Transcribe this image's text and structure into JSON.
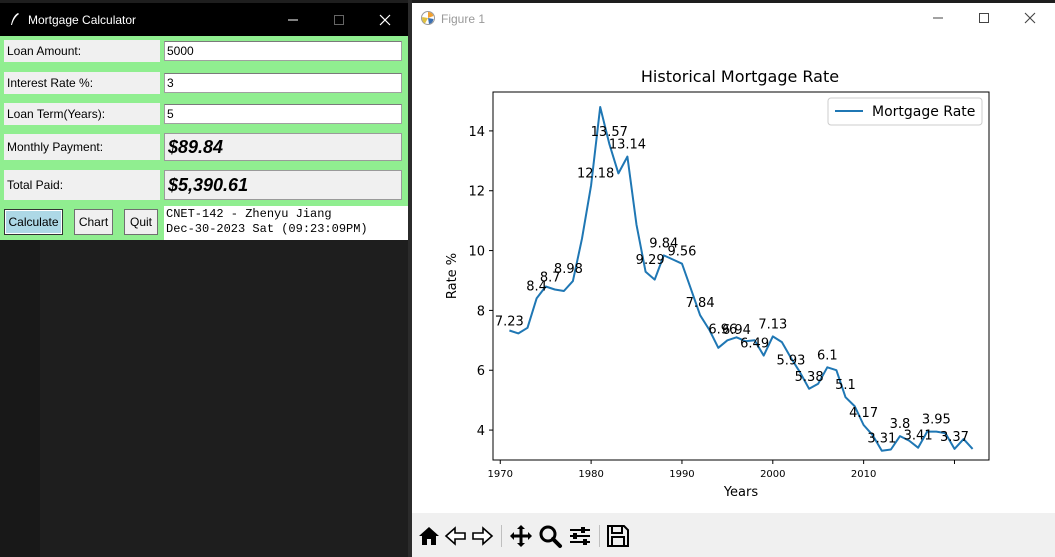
{
  "calc_window": {
    "title": "Mortgage Calculator",
    "fields": {
      "loan_amount_label": "Loan Amount:",
      "loan_amount_value": "5000",
      "interest_rate_label": "Interest Rate %:",
      "interest_rate_value": "3",
      "loan_term_label": "Loan Term(Years):",
      "loan_term_value": "5",
      "monthly_payment_label": "Monthly Payment:",
      "monthly_payment_value": "$89.84",
      "total_paid_label": "Total Paid:",
      "total_paid_value": "$5,390.61"
    },
    "buttons": {
      "calculate": "Calculate",
      "chart": "Chart",
      "quit": "Quit"
    },
    "info_line1": "CNET-142 - Zhenyu Jiang",
    "info_line2": "Dec-30-2023 Sat (09:23:09PM)",
    "colors": {
      "background": "#90ee90",
      "calculate_button": "#add8e6"
    }
  },
  "figure_window": {
    "title": "Figure 1",
    "toolbar_icons": [
      "home-icon",
      "back-icon",
      "forward-icon",
      "pan-icon",
      "zoom-icon",
      "configure-subplots-icon",
      "save-icon"
    ]
  },
  "chart_data": {
    "type": "line",
    "title": "Historical Mortgage Rate",
    "xlabel": "Years",
    "ylabel": "Rate %",
    "legend": "top-right",
    "grid": false,
    "xlim": [
      1969.2,
      2023.8
    ],
    "ylim": [
      3.0,
      15.3
    ],
    "x_ticks": [
      1970,
      1980,
      1990,
      2000,
      2010
    ],
    "y_ticks": [
      4,
      6,
      8,
      10,
      12,
      14
    ],
    "series": [
      {
        "name": "Mortgage Rate",
        "color": "#1f77b4",
        "x": [
          1971,
          1972,
          1973,
          1974,
          1975,
          1976,
          1977,
          1978,
          1979,
          1980,
          1981,
          1982,
          1983,
          1984,
          1985,
          1986,
          1987,
          1988,
          1989,
          1990,
          1991,
          1992,
          1993,
          1994,
          1995,
          1996,
          1997,
          1998,
          1999,
          2000,
          2001,
          2002,
          2003,
          2004,
          2005,
          2006,
          2007,
          2008,
          2009,
          2010,
          2011,
          2012,
          2013,
          2014,
          2015,
          2016,
          2017,
          2018,
          2019,
          2020,
          2021,
          2022
        ],
        "y": [
          7.33,
          7.23,
          7.42,
          8.4,
          8.8,
          8.7,
          8.65,
          8.98,
          10.4,
          12.18,
          14.8,
          13.57,
          12.58,
          13.14,
          10.86,
          9.29,
          9.03,
          9.84,
          9.7,
          9.56,
          8.71,
          7.84,
          7.36,
          6.75,
          7.0,
          7.1,
          6.97,
          7.0,
          6.49,
          7.13,
          6.94,
          6.41,
          5.93,
          5.38,
          5.55,
          6.1,
          6.0,
          5.1,
          4.8,
          4.17,
          3.83,
          3.31,
          3.35,
          3.8,
          3.65,
          3.41,
          3.95,
          3.95,
          3.9,
          3.37,
          3.7,
          3.37
        ],
        "labels": [
          {
            "x": 1971,
            "y": 7.23,
            "text": "7.23"
          },
          {
            "x": 1974,
            "y": 8.4,
            "text": "8.4"
          },
          {
            "x": 1975.5,
            "y": 8.7,
            "text": "8.7"
          },
          {
            "x": 1977.5,
            "y": 8.98,
            "text": "8.98"
          },
          {
            "x": 1980.5,
            "y": 12.18,
            "text": "12.18"
          },
          {
            "x": 1982,
            "y": 13.57,
            "text": "13.57"
          },
          {
            "x": 1984,
            "y": 13.14,
            "text": "13.14"
          },
          {
            "x": 1986.5,
            "y": 9.29,
            "text": "9.29"
          },
          {
            "x": 1988,
            "y": 9.84,
            "text": "9.84"
          },
          {
            "x": 1990,
            "y": 9.56,
            "text": "9.56"
          },
          {
            "x": 1992,
            "y": 7.84,
            "text": "7.84"
          },
          {
            "x": 1994.5,
            "y": 6.96,
            "text": "6.96"
          },
          {
            "x": 1996,
            "y": 6.94,
            "text": "6.94"
          },
          {
            "x": 1998,
            "y": 6.49,
            "text": "6.49"
          },
          {
            "x": 2000,
            "y": 7.13,
            "text": "7.13"
          },
          {
            "x": 2002,
            "y": 5.93,
            "text": "5.93"
          },
          {
            "x": 2004,
            "y": 5.38,
            "text": "5.38"
          },
          {
            "x": 2006,
            "y": 6.1,
            "text": "6.1"
          },
          {
            "x": 2008,
            "y": 5.1,
            "text": "5.1"
          },
          {
            "x": 2010,
            "y": 4.17,
            "text": "4.17"
          },
          {
            "x": 2012,
            "y": 3.31,
            "text": "3.31"
          },
          {
            "x": 2014,
            "y": 3.8,
            "text": "3.8"
          },
          {
            "x": 2016,
            "y": 3.41,
            "text": "3.41"
          },
          {
            "x": 2018,
            "y": 3.95,
            "text": "3.95"
          },
          {
            "x": 2020,
            "y": 3.37,
            "text": "3.37"
          }
        ]
      }
    ]
  }
}
